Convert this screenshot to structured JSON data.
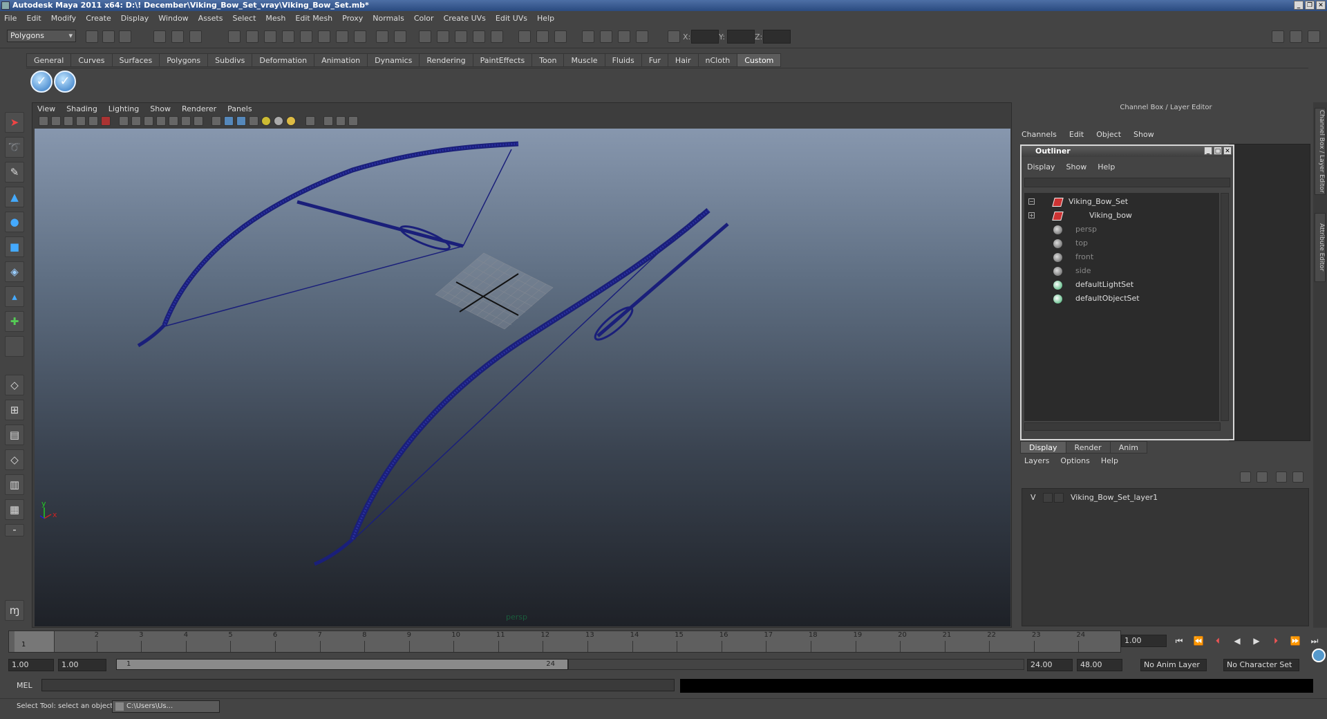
{
  "window": {
    "title": "Autodesk Maya 2011 x64: D:\\! December\\Viking_Bow_Set_vray\\Viking_Bow_Set.mb*",
    "buttons": [
      "_",
      "❐",
      "✕"
    ]
  },
  "menubar": [
    "File",
    "Edit",
    "Modify",
    "Create",
    "Display",
    "Window",
    "Assets",
    "Select",
    "Mesh",
    "Edit Mesh",
    "Proxy",
    "Normals",
    "Color",
    "Create UVs",
    "Edit UVs",
    "Help"
  ],
  "status": {
    "mode": "Polygons",
    "x_label": "X:",
    "y_label": "Y:",
    "z_label": "Z:"
  },
  "shelf": {
    "tabs": [
      "General",
      "Curves",
      "Surfaces",
      "Polygons",
      "Subdivs",
      "Deformation",
      "Animation",
      "Dynamics",
      "Rendering",
      "PaintEffects",
      "Toon",
      "Muscle",
      "Fluids",
      "Fur",
      "Hair",
      "nCloth",
      "Custom"
    ],
    "active_tab": "Custom"
  },
  "viewport": {
    "menu": [
      "View",
      "Shading",
      "Lighting",
      "Show",
      "Renderer",
      "Panels"
    ],
    "camera": "persp",
    "axis_y": "y",
    "axis_x": "x",
    "wire_color": "#1a1f7a"
  },
  "channel_box": {
    "header": "Channel Box / Layer Editor",
    "menu": [
      "Channels",
      "Edit",
      "Object",
      "Show"
    ]
  },
  "side_tabs": [
    "Channel Box / Layer Editor",
    "Attribute Editor"
  ],
  "outliner": {
    "title": "Outliner",
    "menu": [
      "Display",
      "Show",
      "Help"
    ],
    "items": [
      {
        "label": "Viking_Bow_Set",
        "type": "transform",
        "expander": "−",
        "dim": false
      },
      {
        "label": "Viking_bow",
        "type": "transform",
        "expander": "+",
        "dim": false
      },
      {
        "label": "persp",
        "type": "camera",
        "dim": true
      },
      {
        "label": "top",
        "type": "camera",
        "dim": true
      },
      {
        "label": "front",
        "type": "camera",
        "dim": true
      },
      {
        "label": "side",
        "type": "camera",
        "dim": true
      },
      {
        "label": "defaultLightSet",
        "type": "set",
        "dim": false
      },
      {
        "label": "defaultObjectSet",
        "type": "set",
        "dim": false
      }
    ]
  },
  "layer_editor": {
    "tabs": [
      "Display",
      "Render",
      "Anim"
    ],
    "active_tab": "Display",
    "menu": [
      "Layers",
      "Options",
      "Help"
    ],
    "layers": [
      {
        "visible": "V",
        "name": "Viking_Bow_Set_layer1"
      }
    ]
  },
  "timeline": {
    "ticks": [
      "1",
      "2",
      "3",
      "4",
      "5",
      "6",
      "7",
      "8",
      "9",
      "10",
      "11",
      "12",
      "13",
      "14",
      "15",
      "16",
      "17",
      "18",
      "19",
      "20",
      "21",
      "22",
      "23",
      "24"
    ],
    "current_marker": "1",
    "current_frame": "1.00"
  },
  "range": {
    "start": "1.00",
    "playback_start": "1.00",
    "slider_low": "1",
    "slider_high": "24",
    "playback_end": "24.00",
    "end": "48.00",
    "anim_layer": "No Anim Layer",
    "character_set": "No Character Set"
  },
  "mel": {
    "label": "MEL"
  },
  "help_line": {
    "text": "Select Tool: select an object",
    "task": "C:\\Users\\Us..."
  }
}
